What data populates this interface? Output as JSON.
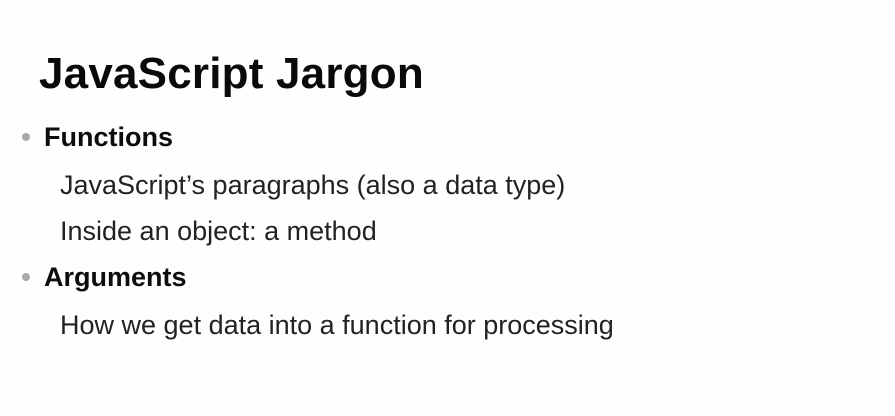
{
  "slide": {
    "title": "JavaScript Jargon",
    "bullets": [
      {
        "label": "Functions",
        "subitems": [
          "JavaScript’s paragraphs (also a data type)",
          "Inside an object: a method"
        ]
      },
      {
        "label": "Arguments",
        "subitems": [
          "How we get data into a function for processing"
        ]
      }
    ]
  }
}
